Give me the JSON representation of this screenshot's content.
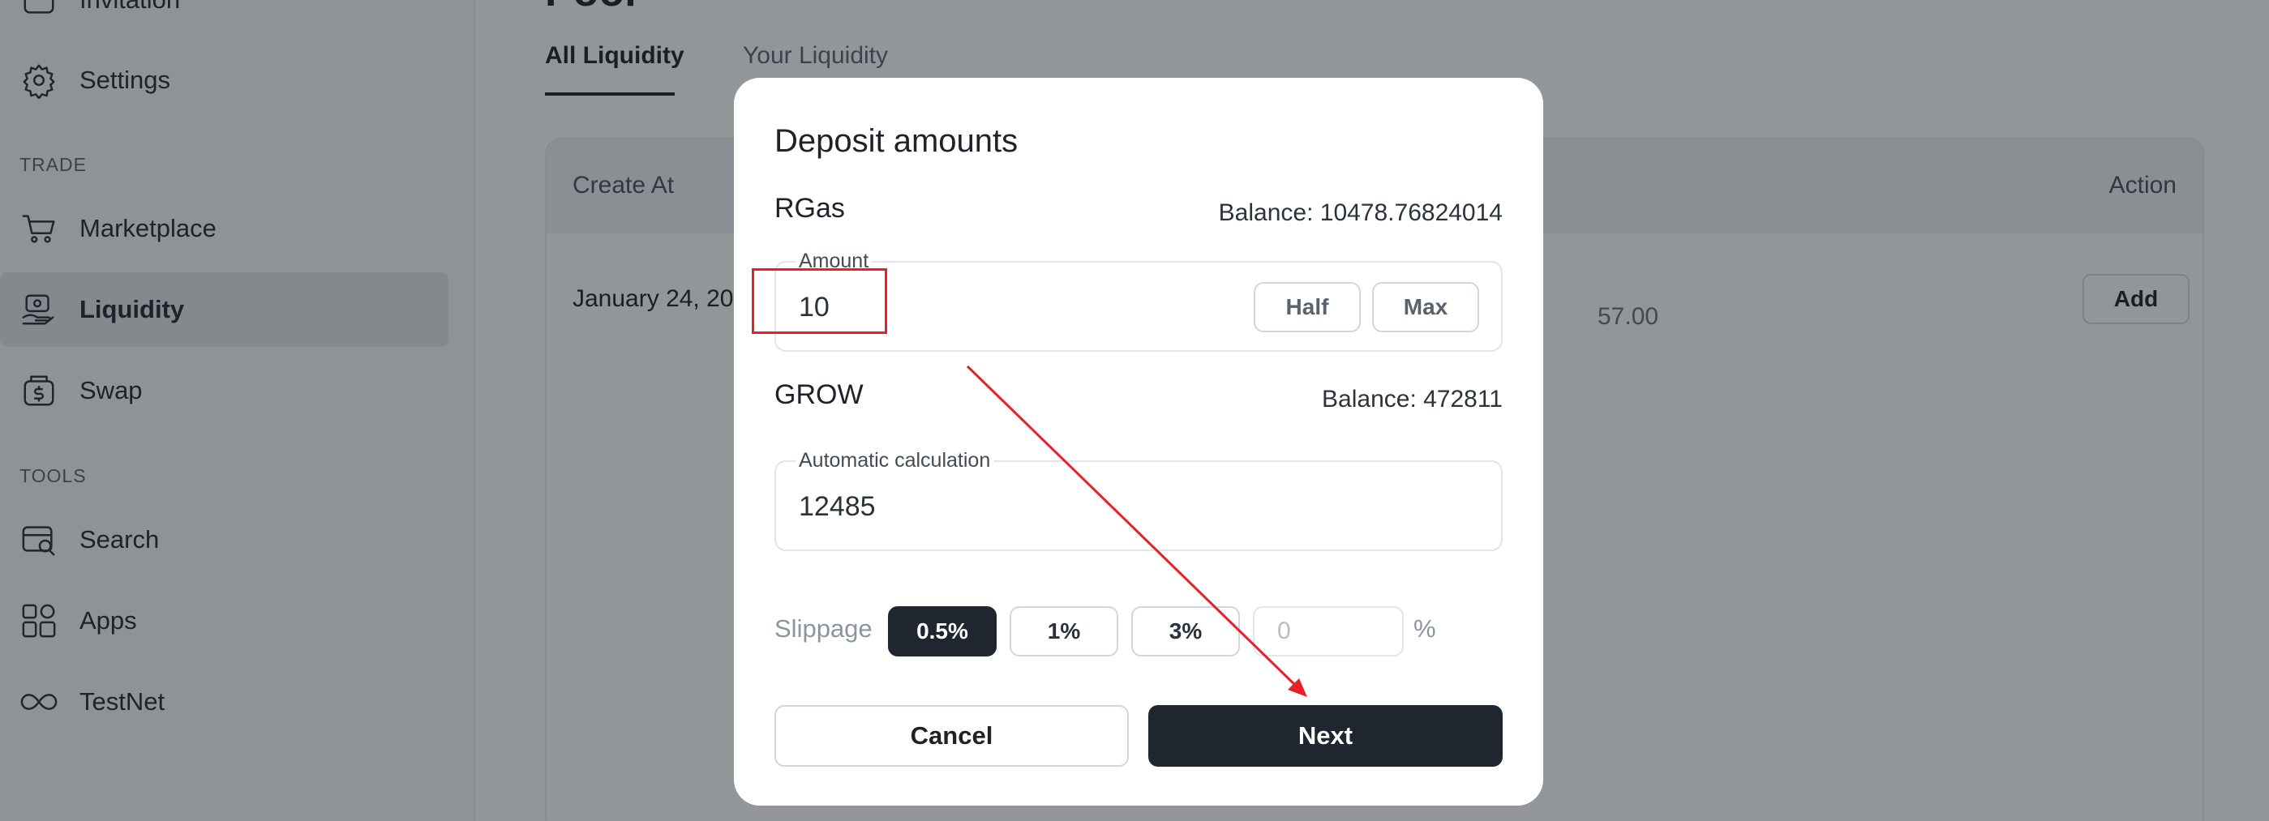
{
  "sidebar": {
    "items_top": [
      {
        "label": "Invitation",
        "icon": "invitation-icon"
      },
      {
        "label": "Settings",
        "icon": "gear-icon"
      }
    ],
    "section_trade": "TRADE",
    "items_trade": [
      {
        "label": "Marketplace",
        "icon": "cart-icon"
      },
      {
        "label": "Liquidity",
        "icon": "liquidity-icon",
        "active": true
      },
      {
        "label": "Swap",
        "icon": "swap-icon"
      }
    ],
    "section_tools": "TOOLS",
    "items_tools": [
      {
        "label": "Search",
        "icon": "search-icon"
      },
      {
        "label": "Apps",
        "icon": "apps-icon"
      },
      {
        "label": "TestNet",
        "icon": "infinity-icon"
      }
    ]
  },
  "main": {
    "page_title": "Pool",
    "tabs": [
      {
        "label": "All Liquidity",
        "active": true
      },
      {
        "label": "Your Liquidity"
      }
    ],
    "table": {
      "headers": {
        "create_at": "Create At",
        "action": "Action"
      },
      "row": {
        "date": "January 24, 20",
        "value": "57.00",
        "action": "Add"
      }
    }
  },
  "modal": {
    "title": "Deposit amounts",
    "token1": {
      "name": "RGas",
      "balance": "Balance: 10478.76824014",
      "field_label": "Amount",
      "value": "10",
      "half_label": "Half",
      "max_label": "Max"
    },
    "token2": {
      "name": "GROW",
      "balance": "Balance: 472811",
      "field_label": "Automatic calculation",
      "value": "12485"
    },
    "slippage": {
      "label": "Slippage",
      "options": [
        "0.5%",
        "1%",
        "3%"
      ],
      "selected": "0.5%",
      "custom_placeholder": "0",
      "suffix": "%"
    },
    "cancel_label": "Cancel",
    "next_label": "Next"
  },
  "colors": {
    "primary_dark": "#1f2630",
    "annotation_red": "#e8202a",
    "overlay": "rgba(20,26,33,0.46)"
  }
}
